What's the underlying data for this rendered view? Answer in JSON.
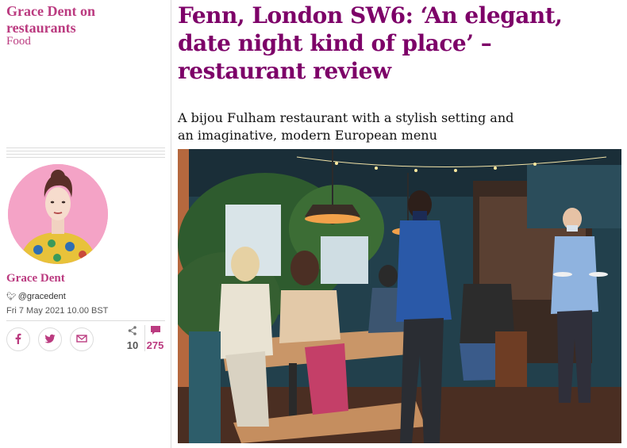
{
  "series": {
    "title": "Grace Dent on restaurants",
    "section": "Food"
  },
  "byline": {
    "author": "Grace Dent",
    "twitter_handle": "@gracedent",
    "date": "Fri 7 May 2021 10.00 BST"
  },
  "share": {
    "icons": [
      "facebook-icon",
      "twitter-icon",
      "email-icon"
    ],
    "share_count": "10",
    "comment_count": "275"
  },
  "article": {
    "headline": "Fenn, London SW6: ‘An elegant, date night kind of place’ – restaurant review",
    "standfirst": "A bijou Fulham restaurant with a stylish setting and an imaginative, modern European menu"
  },
  "colors": {
    "accent": "#bb3b80",
    "headline": "#7d0068",
    "avatar_bg": "#f4a3c6"
  }
}
